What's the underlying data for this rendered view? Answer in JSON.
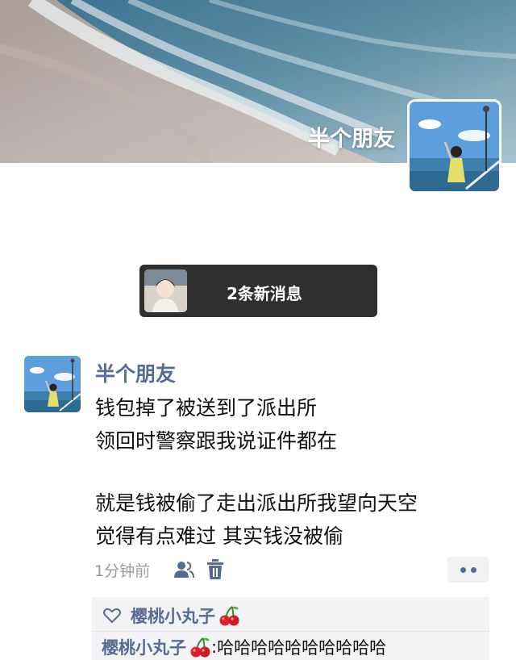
{
  "profile": {
    "name": "半个朋友",
    "new_messages": "2条新消息"
  },
  "post": {
    "author": "半个朋友",
    "lines": [
      "钱包掉了被送到了派出所",
      "领回时警察跟我说证件都在",
      "",
      "就是钱被偷了走出派出所我望向天空",
      "觉得有点难过  其实钱没被偷"
    ],
    "time": "1分钟前"
  },
  "likes": {
    "names": [
      "樱桃小丸子"
    ]
  },
  "comments": [
    {
      "author": "樱桃小丸子",
      "text": "哈哈哈哈哈哈哈哈哈哈"
    }
  ],
  "icons": {
    "like": "heart-icon",
    "emoji": "cherry-emoji",
    "visibility": "friends-icon",
    "delete": "delete-icon",
    "more": "more-icon"
  },
  "colors": {
    "link": "#576b95",
    "muted": "#9a9a9a",
    "banner": "#2f2f2f"
  }
}
